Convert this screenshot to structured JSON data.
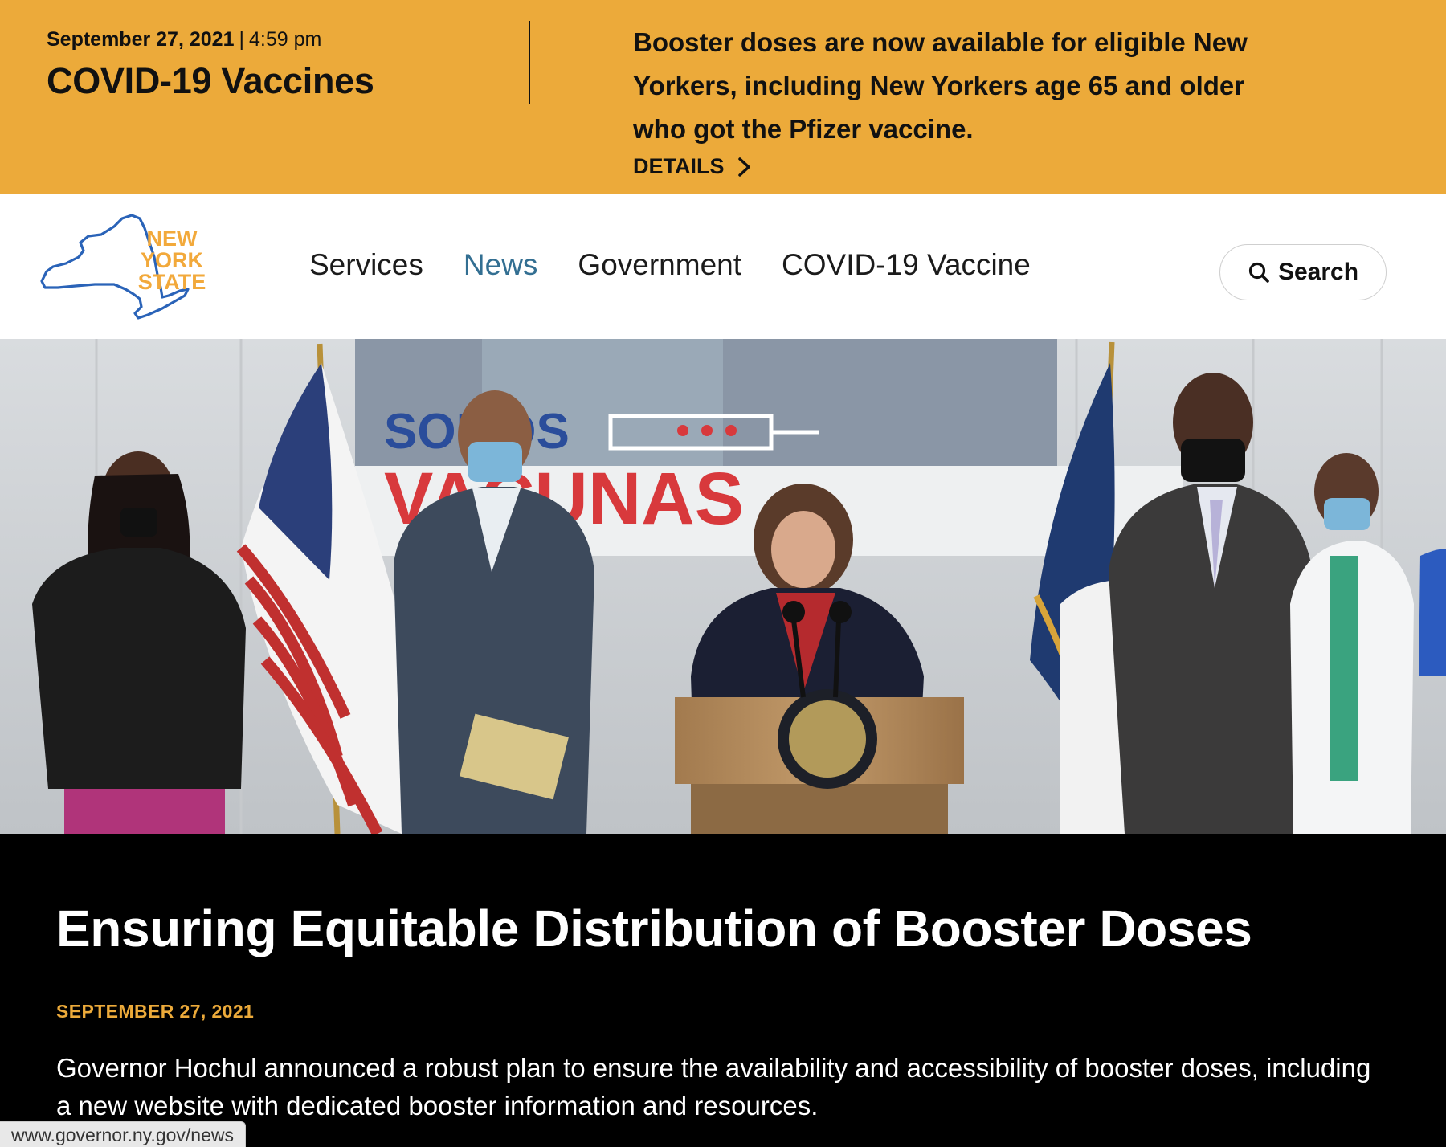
{
  "alert": {
    "date": "September 27, 2021",
    "separator": "|",
    "time": "4:59 pm",
    "title": "COVID-19 Vaccines",
    "message": "Booster doses are now available for eligible New Yorkers, including New Yorkers age 65 and older who got the Pfizer vaccine.",
    "details_label": "DETAILS",
    "details_icon": "chevron-right-icon",
    "background_color": "#ecaa3a"
  },
  "header": {
    "logo_lines": [
      "NEW",
      "YORK",
      "STATE"
    ],
    "logo_colors": {
      "outline": "#2a63b8",
      "text": "#f2a93b"
    },
    "nav": [
      {
        "label": "Services",
        "active": false
      },
      {
        "label": "News",
        "active": true
      },
      {
        "label": "Government",
        "active": false
      },
      {
        "label": "COVID-19 Vaccine",
        "active": false
      }
    ],
    "active_color": "#336f92",
    "search_label": "Search",
    "search_icon": "magnifier-icon"
  },
  "hero": {
    "banner_text_top": "SOMOS",
    "banner_text_bottom": "VACUNAS"
  },
  "article": {
    "title": "Ensuring Equitable Distribution of Booster Doses",
    "date": "SEPTEMBER 27, 2021",
    "summary": "Governor Hochul announced a robust plan to ensure the availability and accessibility of booster doses, including a new website with dedicated booster information and resources.",
    "date_color": "#ecaa3a"
  },
  "status_bar": {
    "url": "www.governor.ny.gov/news"
  }
}
